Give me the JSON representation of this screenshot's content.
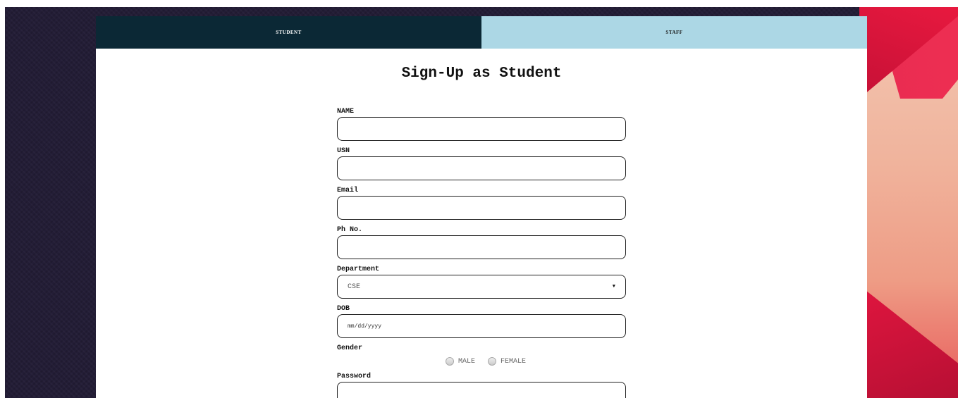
{
  "tabs": {
    "student": "STUDENT",
    "staff": "STAFF",
    "active": "student"
  },
  "form": {
    "title": "Sign-Up as Student",
    "name_label": "NAME",
    "usn_label": "USN",
    "email_label": "Email",
    "phone_label": "Ph No.",
    "department_label": "Department",
    "department_value": "CSE",
    "dob_label": "DOB",
    "dob_placeholder": "mm/dd/yyyy",
    "gender_label": "Gender",
    "gender_options": [
      "MALE",
      "FEMALE"
    ],
    "password_label": "Password"
  },
  "colors": {
    "tab_active_bg": "#0b2835",
    "tab_inactive_bg": "#acd7e5",
    "page_bg": "#231d36",
    "accent_red": "#e8193f"
  }
}
